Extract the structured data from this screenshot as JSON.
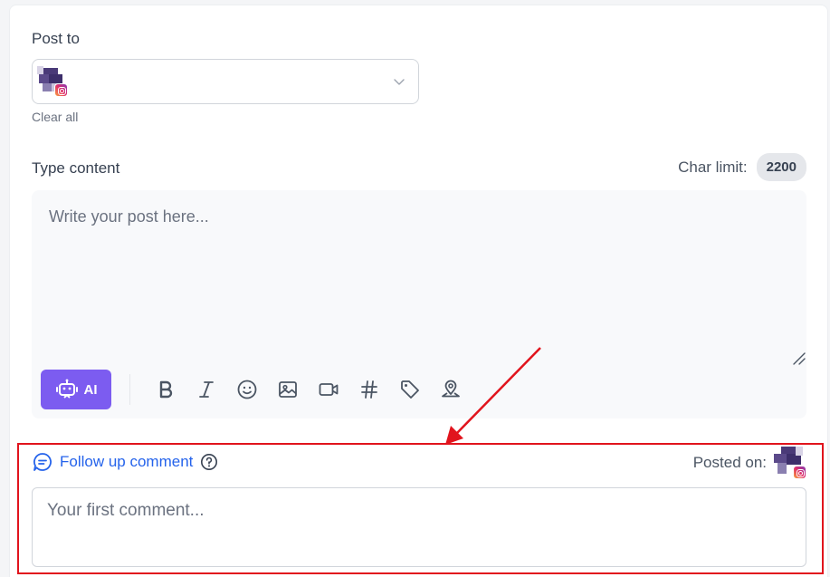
{
  "post_to": {
    "label": "Post to",
    "account_platform": "instagram",
    "clear_label": "Clear all"
  },
  "content": {
    "label": "Type content",
    "char_limit_label": "Char limit:",
    "char_limit_value": "2200",
    "placeholder": "Write your post here...",
    "ai_label": "AI",
    "toolbar_icons": [
      "ai-bot-icon",
      "bold-icon",
      "italic-icon",
      "emoji-icon",
      "image-icon",
      "video-icon",
      "hashtag-icon",
      "tag-icon",
      "location-icon"
    ]
  },
  "follow_up": {
    "label": "Follow up comment",
    "posted_on_label": "Posted on:",
    "placeholder": "Your first comment..."
  },
  "colors": {
    "accent": "#7c5cf0",
    "link": "#2563eb",
    "annotation": "#e1141d"
  }
}
